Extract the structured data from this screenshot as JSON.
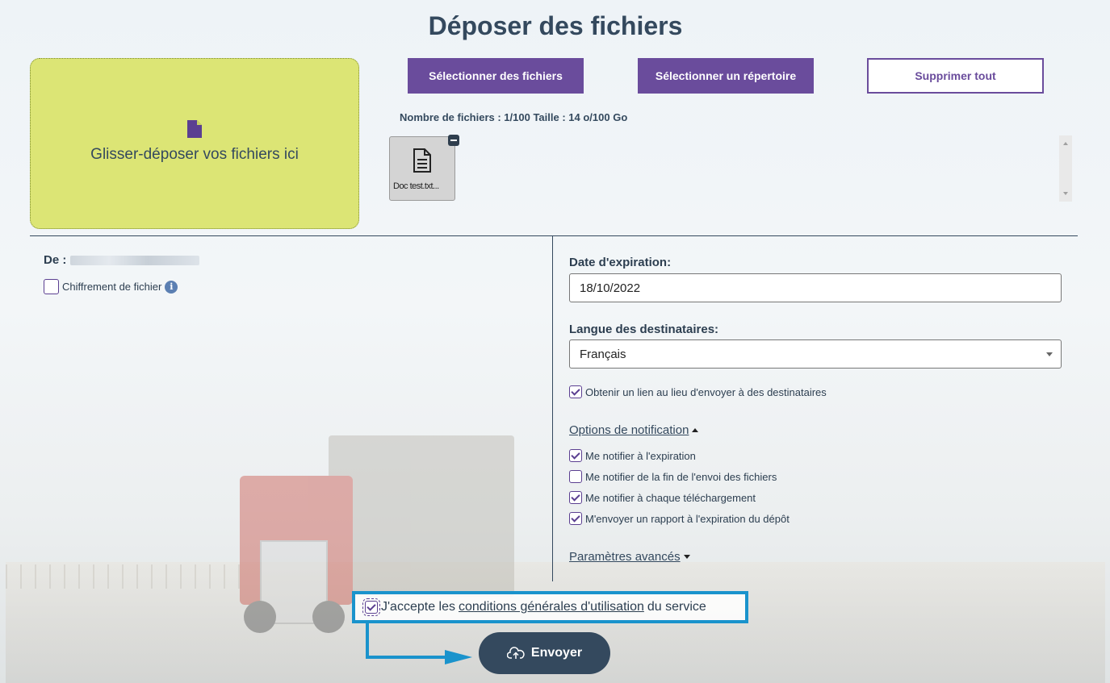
{
  "page": {
    "title": "Déposer des fichiers"
  },
  "dropzone": {
    "label": "Glisser-déposer vos fichiers ici",
    "icon": "file-icon"
  },
  "toolbar": {
    "select_files_label": "Sélectionner des fichiers",
    "select_folder_label": "Sélectionner un répertoire",
    "delete_all_label": "Supprimer tout"
  },
  "upload_info": {
    "counts": "Nombre de fichiers : 1/100 Taille : 14 o/100 Go"
  },
  "files": [
    {
      "name": "Doc test.txt...",
      "icon": "text-document-icon"
    }
  ],
  "sender": {
    "label": "De :"
  },
  "encryption": {
    "label": "Chiffrement de fichier",
    "checked": false,
    "info_icon": "i"
  },
  "expiration": {
    "label": "Date d'expiration:",
    "value": "18/10/2022"
  },
  "language": {
    "label": "Langue des destinataires:",
    "value": "Français"
  },
  "get_link": {
    "label": "Obtenir un lien au lieu d'envoyer à des destinataires",
    "checked": true
  },
  "notifications": {
    "toggle_label": "Options de notification",
    "options": [
      {
        "label": "Me notifier à l'expiration",
        "checked": true
      },
      {
        "label": "Me notifier de la fin de l'envoi des fichiers",
        "checked": false
      },
      {
        "label": "Me notifier à chaque téléchargement",
        "checked": true
      },
      {
        "label": "M'envoyer un rapport à l'expiration du dépôt",
        "checked": true
      }
    ]
  },
  "advanced": {
    "toggle_label": "Paramètres avancés"
  },
  "terms": {
    "prefix": "J'accepte les",
    "link": "conditions générales d'utilisation",
    "suffix": "du service",
    "checked": true
  },
  "send": {
    "label": "Envoyer",
    "icon": "cloud-upload-icon"
  },
  "colors": {
    "accent": "#6a4c9c",
    "dropzone": "#dce575",
    "highlight": "#1a93cc",
    "send": "#34495e"
  }
}
